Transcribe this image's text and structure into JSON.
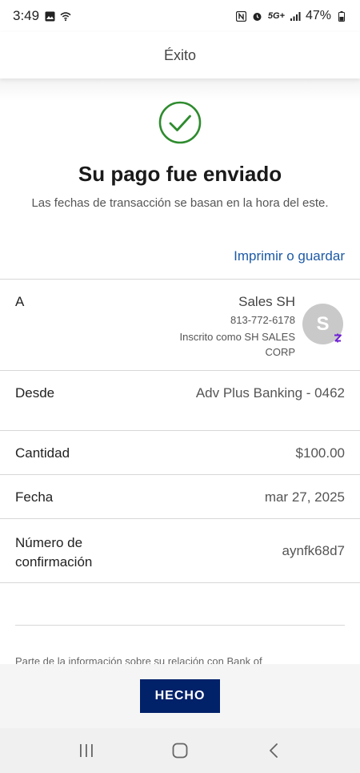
{
  "status_bar": {
    "time": "3:49",
    "network": "5G+",
    "battery": "47%"
  },
  "header": {
    "title": "Éxito"
  },
  "success": {
    "icon": "check-circle-icon",
    "title": "Su pago fue enviado",
    "subtitle": "Las fechas de transacción se basan en la hora del este.",
    "print_link": "Imprimir o guardar",
    "accent_color": "#2e8b2e"
  },
  "details": {
    "to": {
      "label": "A",
      "name": "Sales SH",
      "phone": "813-772-6178",
      "enrolled": "Inscrito como SH SALES CORP",
      "avatar_initial": "S",
      "badge_icon": "zelle-icon"
    },
    "from": {
      "label": "Desde",
      "value": "Adv Plus Banking - 0462"
    },
    "amount": {
      "label": "Cantidad",
      "value": "$100.00"
    },
    "date": {
      "label": "Fecha",
      "value": "mar 27, 2025"
    },
    "confirmation": {
      "label": "Número de confirmación",
      "value": "aynfk68d7"
    }
  },
  "footer_note": "Parte de la información sobre su relación con Bank of",
  "done_button": {
    "label": "HECHO",
    "color": "#012169"
  },
  "nav": {
    "recents": "recents-icon",
    "home": "home-icon",
    "back": "back-icon"
  }
}
